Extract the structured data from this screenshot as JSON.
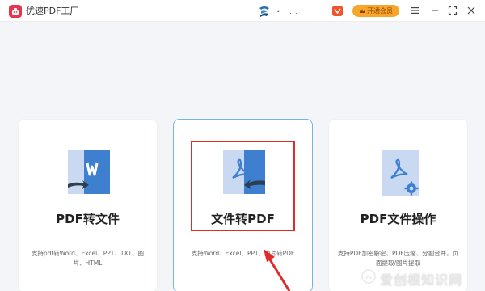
{
  "app": {
    "title": "优速PDF工厂",
    "user_name": "• . . ."
  },
  "header": {
    "vip_label": "开通会员"
  },
  "cards": [
    {
      "title": "PDF转文件",
      "description": "支持pdf转Word、Excel、PPT、TXT、图片、HTML"
    },
    {
      "title": "文件转PDF",
      "description": "支持Word、Excel、PPT、图片转PDF"
    },
    {
      "title": "PDF文件操作",
      "description": "支持PDF加密解密、PDF压缩、分割合并，页面提取/图片提取"
    }
  ],
  "watermark": {
    "text": "爱创根知识网"
  },
  "colors": {
    "accent": "#3f7fd0",
    "vip": "#f7a62b",
    "highlight": "#e02b2b"
  },
  "icons": [
    "app-logo-icon",
    "vip-icon",
    "menu-icon",
    "minimize-icon",
    "maximize-icon",
    "close-icon",
    "word-icon",
    "pdf-icon",
    "pdf-settings-icon",
    "arrow-icon"
  ]
}
